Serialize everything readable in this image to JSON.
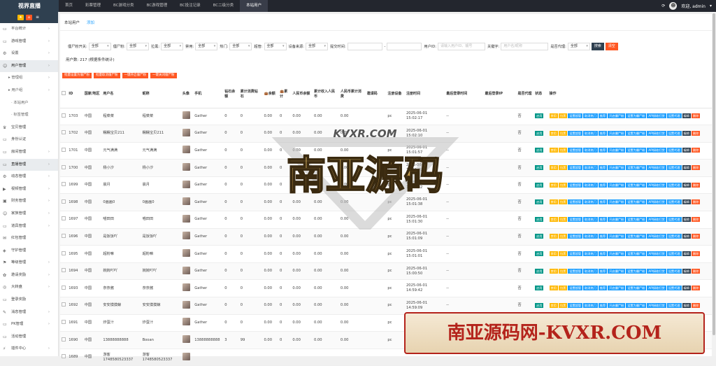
{
  "app": {
    "title": "视界直播"
  },
  "topnav": [
    "首页",
    "彩票管理",
    "BC游戏分类",
    "BC游戏管理",
    "BC投注记录",
    "BC二级分类",
    "本站用户"
  ],
  "topnav_active": 6,
  "topright": {
    "greeting": "欢迎, admin"
  },
  "sidebar": {
    "items": [
      {
        "label": "平台统计",
        "icon": "monitor-icon",
        "arrow": true,
        "type": "top"
      },
      {
        "label": "游戏管理",
        "icon": "monitor-icon",
        "arrow": true,
        "type": "top"
      },
      {
        "label": "设置",
        "icon": "gear-icon",
        "arrow": true,
        "type": "top"
      },
      {
        "label": "用户管理",
        "icon": "users-icon",
        "arrow": true,
        "type": "top",
        "highlight": true
      },
      {
        "label": "管理组",
        "type": "sub",
        "arrow": true
      },
      {
        "label": "用户组",
        "type": "sub",
        "arrow": true
      },
      {
        "label": "本站用户",
        "type": "sub2"
      },
      {
        "label": "标签管理",
        "type": "sub2"
      },
      {
        "label": "宝贝管理",
        "icon": "trophy-icon",
        "type": "top"
      },
      {
        "label": "身份认证",
        "icon": "monitor-icon",
        "type": "top"
      },
      {
        "label": "房间管理",
        "icon": "monitor-icon",
        "arrow": true,
        "type": "top"
      },
      {
        "label": "直播管理",
        "icon": "monitor-icon",
        "arrow": true,
        "type": "top",
        "highlight": true
      },
      {
        "label": "动态管理",
        "icon": "gear-icon",
        "arrow": true,
        "type": "top"
      },
      {
        "label": "视频管理",
        "icon": "video-icon",
        "arrow": true,
        "type": "top"
      },
      {
        "label": "财务管理",
        "icon": "wallet-icon",
        "arrow": true,
        "type": "top"
      },
      {
        "label": "家族管理",
        "icon": "users-icon",
        "arrow": true,
        "type": "top"
      },
      {
        "label": "道具管理",
        "icon": "monitor-icon",
        "arrow": true,
        "type": "top"
      },
      {
        "label": "红包管理",
        "icon": "envelope-icon",
        "type": "top"
      },
      {
        "label": "守护管理",
        "icon": "shield-icon",
        "type": "top"
      },
      {
        "label": "等级管理",
        "icon": "level-icon",
        "arrow": true,
        "type": "top"
      },
      {
        "label": "邀请奖励",
        "icon": "gift-icon",
        "arrow": true,
        "type": "top"
      },
      {
        "label": "大转盘",
        "icon": "wheel-icon",
        "arrow": true,
        "type": "top"
      },
      {
        "label": "登录奖励",
        "icon": "monitor-icon",
        "type": "top"
      },
      {
        "label": "消息管理",
        "icon": "message-icon",
        "arrow": true,
        "type": "top"
      },
      {
        "label": "PK管理",
        "icon": "monitor-icon",
        "arrow": true,
        "type": "top"
      },
      {
        "label": "活动管理",
        "icon": "monitor-icon",
        "type": "top"
      },
      {
        "label": "插件中心",
        "icon": "plug-icon",
        "arrow": true,
        "type": "top"
      }
    ]
  },
  "tabs": {
    "active": "本站用户",
    "add": "添加"
  },
  "filters": {
    "items": [
      {
        "label": "僵尸粉开关:",
        "value": "全部"
      },
      {
        "label": "僵尸粉:",
        "value": "全部"
      },
      {
        "label": "拉黑:",
        "value": "全部"
      },
      {
        "label": "禁用:",
        "value": "全部"
      },
      {
        "label": "热门:",
        "value": "全部"
      },
      {
        "label": "超管:",
        "value": "全部"
      },
      {
        "label": "设备来源:",
        "value": "全部"
      }
    ],
    "time_label": "提交时间:",
    "time_dash": "-",
    "user_id_label": "用户ID:",
    "user_id_placeholder": "请输入用户ID、靓号",
    "keyword_label": "关键字:",
    "keyword_placeholder": "用户名/昵称",
    "agent_label": "是否代理:",
    "agent_value": "全部",
    "search_label": "搜索",
    "clear_label": "清空"
  },
  "count_text": "用户数: 217 (根据条件统计)",
  "batch_buttons": [
    "批量设置为僵尸粉",
    "批量取消僵尸粉",
    "一键开启僵尸粉",
    "一键关闭僵尸粉"
  ],
  "table": {
    "headers": [
      "",
      "ID",
      "国家/地区",
      "用户名",
      "昵称",
      "头像",
      "手机",
      "钻石余额",
      "累计消费钻石",
      "余额",
      "累计",
      "人民币余额",
      "累计收入人民币",
      "人民币累计消费",
      "邀请码",
      "注册设备",
      "注册时间",
      "最后登录时间",
      "最后登录IP",
      "是否代理",
      "状态",
      "操作"
    ],
    "rows": [
      {
        "id": "1703",
        "country": "中国",
        "user": "程菜菜",
        "nick": "程菜菜",
        "phone": "Gather",
        "diamond": "0",
        "diamond_spent": "0",
        "bal": "0.00",
        "total": "0",
        "rmb": "0.00",
        "rmb_income": "0.00",
        "rmb_spent": "0.00",
        "invite": "",
        "device": "pc",
        "reg": "2025-06-01 15:02:17",
        "last": "--",
        "ip": "",
        "agent": "否",
        "status": "启用"
      },
      {
        "id": "1702",
        "country": "中国",
        "user": "糯糯宝贝211",
        "nick": "糯糯宝贝211",
        "phone": "Gather",
        "diamond": "0",
        "diamond_spent": "0",
        "bal": "0.00",
        "total": "0",
        "rmb": "0.00",
        "rmb_income": "0.00",
        "rmb_spent": "0.00",
        "invite": "",
        "device": "pc",
        "reg": "2025-06-01 15:02:10",
        "last": "--",
        "ip": "",
        "agent": "否",
        "status": "启用"
      },
      {
        "id": "1701",
        "country": "中国",
        "user": "元气满满",
        "nick": "元气满满",
        "phone": "Gather",
        "diamond": "0",
        "diamond_spent": "0",
        "bal": "0.00",
        "total": "0",
        "rmb": "0.00",
        "rmb_income": "0.00",
        "rmb_spent": "0.00",
        "invite": "",
        "device": "pc",
        "reg": "2025-06-01 15:01:57",
        "last": "--",
        "ip": "",
        "agent": "否",
        "status": "启用"
      },
      {
        "id": "1700",
        "country": "中国",
        "user": "杨小汐",
        "nick": "杨小汐",
        "phone": "Gather",
        "diamond": "0",
        "diamond_spent": "0",
        "bal": "0.00",
        "total": "0",
        "rmb": "0.00",
        "rmb_income": "0.00",
        "rmb_spent": "0.00",
        "invite": "",
        "device": "pc",
        "reg": "2025-06-01 15:01:49",
        "last": "--",
        "ip": "",
        "agent": "否",
        "status": "启用"
      },
      {
        "id": "1699",
        "country": "中国",
        "user": "晨月",
        "nick": "晨月",
        "phone": "Gather",
        "diamond": "0",
        "diamond_spent": "0",
        "bal": "0.00",
        "total": "0",
        "rmb": "0.00",
        "rmb_income": "0.00",
        "rmb_spent": "0.00",
        "invite": "",
        "device": "pc",
        "reg": "2025-06-01 15:01:42",
        "last": "--",
        "ip": "",
        "agent": "否",
        "status": "启用"
      },
      {
        "id": "1698",
        "country": "中国",
        "user": "0画画0",
        "nick": "0画画0",
        "phone": "Gather",
        "diamond": "0",
        "diamond_spent": "0",
        "bal": "0.00",
        "total": "0",
        "rmb": "0.00",
        "rmb_income": "0.00",
        "rmb_spent": "0.00",
        "invite": "",
        "device": "pc",
        "reg": "2025-06-01 15:01:38",
        "last": "--",
        "ip": "",
        "agent": "否",
        "status": "启用"
      },
      {
        "id": "1697",
        "country": "中国",
        "user": "喵田田",
        "nick": "喵田田",
        "phone": "Gather",
        "diamond": "0",
        "diamond_spent": "0",
        "bal": "0.00",
        "total": "0",
        "rmb": "0.00",
        "rmb_income": "0.00",
        "rmb_spent": "0.00",
        "invite": "",
        "device": "pc",
        "reg": "2025-06-01 15:01:30",
        "last": "--",
        "ip": "",
        "agent": "否",
        "status": "启用"
      },
      {
        "id": "1696",
        "country": "中国",
        "user": "是饭饭吖",
        "nick": "是饭饭吖",
        "phone": "Gather",
        "diamond": "0",
        "diamond_spent": "0",
        "bal": "0.00",
        "total": "0",
        "rmb": "0.00",
        "rmb_income": "0.00",
        "rmb_spent": "0.00",
        "invite": "",
        "device": "pc",
        "reg": "2025-06-01 15:01:09",
        "last": "--",
        "ip": "",
        "agent": "否",
        "status": "启用"
      },
      {
        "id": "1695",
        "country": "中国",
        "user": "超粉嘛",
        "nick": "超粉嘛",
        "phone": "Gather",
        "diamond": "0",
        "diamond_spent": "0",
        "bal": "0.00",
        "total": "0",
        "rmb": "0.00",
        "rmb_income": "0.00",
        "rmb_spent": "0.00",
        "invite": "",
        "device": "pc",
        "reg": "2025-06-01 15:01:01",
        "last": "--",
        "ip": "",
        "agent": "否",
        "status": "启用"
      },
      {
        "id": "1694",
        "country": "中国",
        "user": "婉婉吖吖",
        "nick": "婉婉吖吖",
        "phone": "Gather",
        "diamond": "0",
        "diamond_spent": "0",
        "bal": "0.00",
        "total": "0",
        "rmb": "0.00",
        "rmb_income": "0.00",
        "rmb_spent": "0.00",
        "invite": "",
        "device": "pc",
        "reg": "2025-06-01 15:00:50",
        "last": "--",
        "ip": "",
        "agent": "否",
        "status": "启用"
      },
      {
        "id": "1693",
        "country": "中国",
        "user": "奈奈酱",
        "nick": "奈奈酱",
        "phone": "Gather",
        "diamond": "0",
        "diamond_spent": "0",
        "bal": "0.00",
        "total": "0",
        "rmb": "0.00",
        "rmb_income": "0.00",
        "rmb_spent": "0.00",
        "invite": "",
        "device": "pc",
        "reg": "2025-06-01 14:59:42",
        "last": "--",
        "ip": "",
        "agent": "否",
        "status": "启用"
      },
      {
        "id": "1692",
        "country": "中国",
        "user": "安安摸摸鲸",
        "nick": "安安摸摸鲸",
        "phone": "Gather",
        "diamond": "0",
        "diamond_spent": "0",
        "bal": "0.00",
        "total": "0",
        "rmb": "0.00",
        "rmb_income": "0.00",
        "rmb_spent": "0.00",
        "invite": "",
        "device": "pc",
        "reg": "2025-06-01 14:59:09",
        "last": "--",
        "ip": "",
        "agent": "否",
        "status": "启用"
      },
      {
        "id": "1691",
        "country": "中国",
        "user": "炸蛋汁",
        "nick": "炸蛋汁",
        "phone": "Gather",
        "diamond": "0",
        "diamond_spent": "0",
        "bal": "0.00",
        "total": "0",
        "rmb": "0.00",
        "rmb_income": "0.00",
        "rmb_spent": "0.00",
        "invite": "",
        "device": "pc",
        "reg": "2025-06-01 14:58:51",
        "last": "--",
        "ip": "",
        "agent": "否",
        "status": "启用"
      },
      {
        "id": "1690",
        "country": "中国",
        "user": "13888888888",
        "nick": "Booan",
        "phone": "13888888888",
        "diamond": "3",
        "diamond_spent": "99",
        "bal": "0.00",
        "total": "0",
        "rmb": "0.00",
        "rmb_income": "0.00",
        "rmb_spent": "0.00",
        "invite": "",
        "device": "pc",
        "reg": "",
        "last": "",
        "ip": "",
        "agent": "",
        "status": ""
      },
      {
        "id": "1689",
        "country": "中国",
        "user": "游客 1748580523337",
        "nick": "游客 1748580523337",
        "phone": "",
        "diamond": "",
        "diamond_spent": "",
        "bal": "",
        "total": "",
        "rmb": "",
        "rmb_income": "",
        "rmb_spent": "",
        "invite": "",
        "device": "",
        "reg": "",
        "last": "",
        "ip": "",
        "agent": "",
        "status": ""
      }
    ],
    "ops": [
      {
        "label": "禁用",
        "color": "o"
      },
      {
        "label": "拉黑",
        "color": "o"
      },
      {
        "label": "设置超管",
        "color": "b"
      },
      {
        "label": "取消热门",
        "color": "b"
      },
      {
        "label": "推荐",
        "color": "b"
      },
      {
        "label": "开启僵尸粉",
        "color": "b"
      },
      {
        "label": "设置为僵尸粉",
        "color": "b"
      },
      {
        "label": "API接收打赏",
        "color": "b"
      },
      {
        "label": "设置代理",
        "color": "b"
      },
      {
        "label": "编辑",
        "color": "g"
      },
      {
        "label": "删除",
        "color": "r"
      }
    ]
  },
  "watermark": {
    "top": "KVXR.COM",
    "main": "南亚源码"
  },
  "footbanner": {
    "text": "南亚源码网-KVXR.COM"
  },
  "colors": {
    "topbar": "#23262e",
    "brand": "#2f4050",
    "accent": "#1E9FFF",
    "danger": "#FF5722",
    "warn": "#FFB800",
    "success": "#009688"
  }
}
